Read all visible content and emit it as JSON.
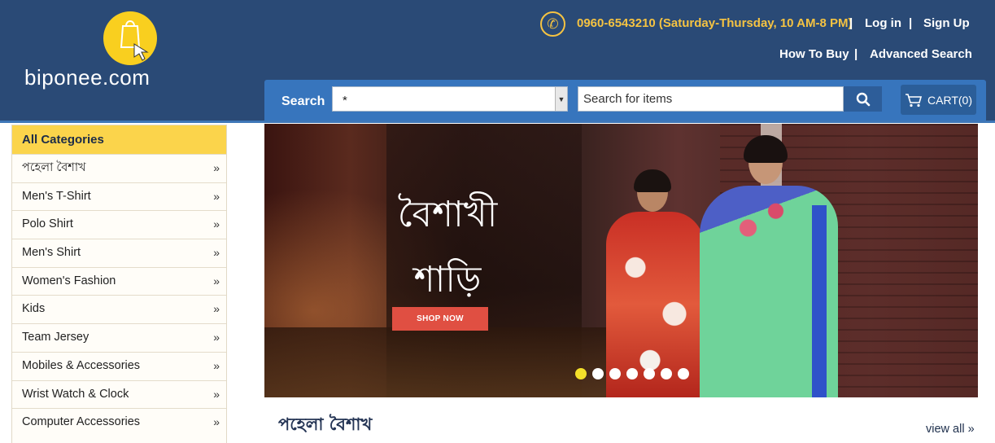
{
  "header": {
    "logo_text": "biponee.com",
    "phone": "0960-6543210 (Saturday-Thursday, 10 AM-8 PM)",
    "links": {
      "login": "Log in",
      "signup": "Sign Up",
      "how_to_buy": "How To Buy",
      "advanced_search": "Advanced Search"
    },
    "separator": "|"
  },
  "search": {
    "label": "Search",
    "category_value": "*",
    "placeholder": "Search for items",
    "cart_label": "CART(0)"
  },
  "sidebar": {
    "title": "All Categories",
    "items": [
      {
        "label": "পহেলা বৈশাখ"
      },
      {
        "label": "Men's T-Shirt"
      },
      {
        "label": "Polo Shirt"
      },
      {
        "label": "Men's Shirt"
      },
      {
        "label": "Women's Fashion"
      },
      {
        "label": "Kids"
      },
      {
        "label": "Team Jersey"
      },
      {
        "label": "Mobiles & Accessories"
      },
      {
        "label": "Wrist Watch & Clock"
      },
      {
        "label": "Computer Accessories"
      }
    ]
  },
  "banner": {
    "line1": "বৈশাখী",
    "line2": "শাড়ি",
    "button_label": "SHOP NOW",
    "slides_total": 7,
    "active_slide": 1
  },
  "section": {
    "title": "পহেলা বৈশাখ",
    "view_all": "view all »"
  },
  "colors": {
    "header_bg": "#2a4a76",
    "accent_yellow": "#f5c342",
    "search_bar": "#3775bd",
    "sidebar_head": "#fbd44b",
    "shop_button": "#e04f42"
  }
}
